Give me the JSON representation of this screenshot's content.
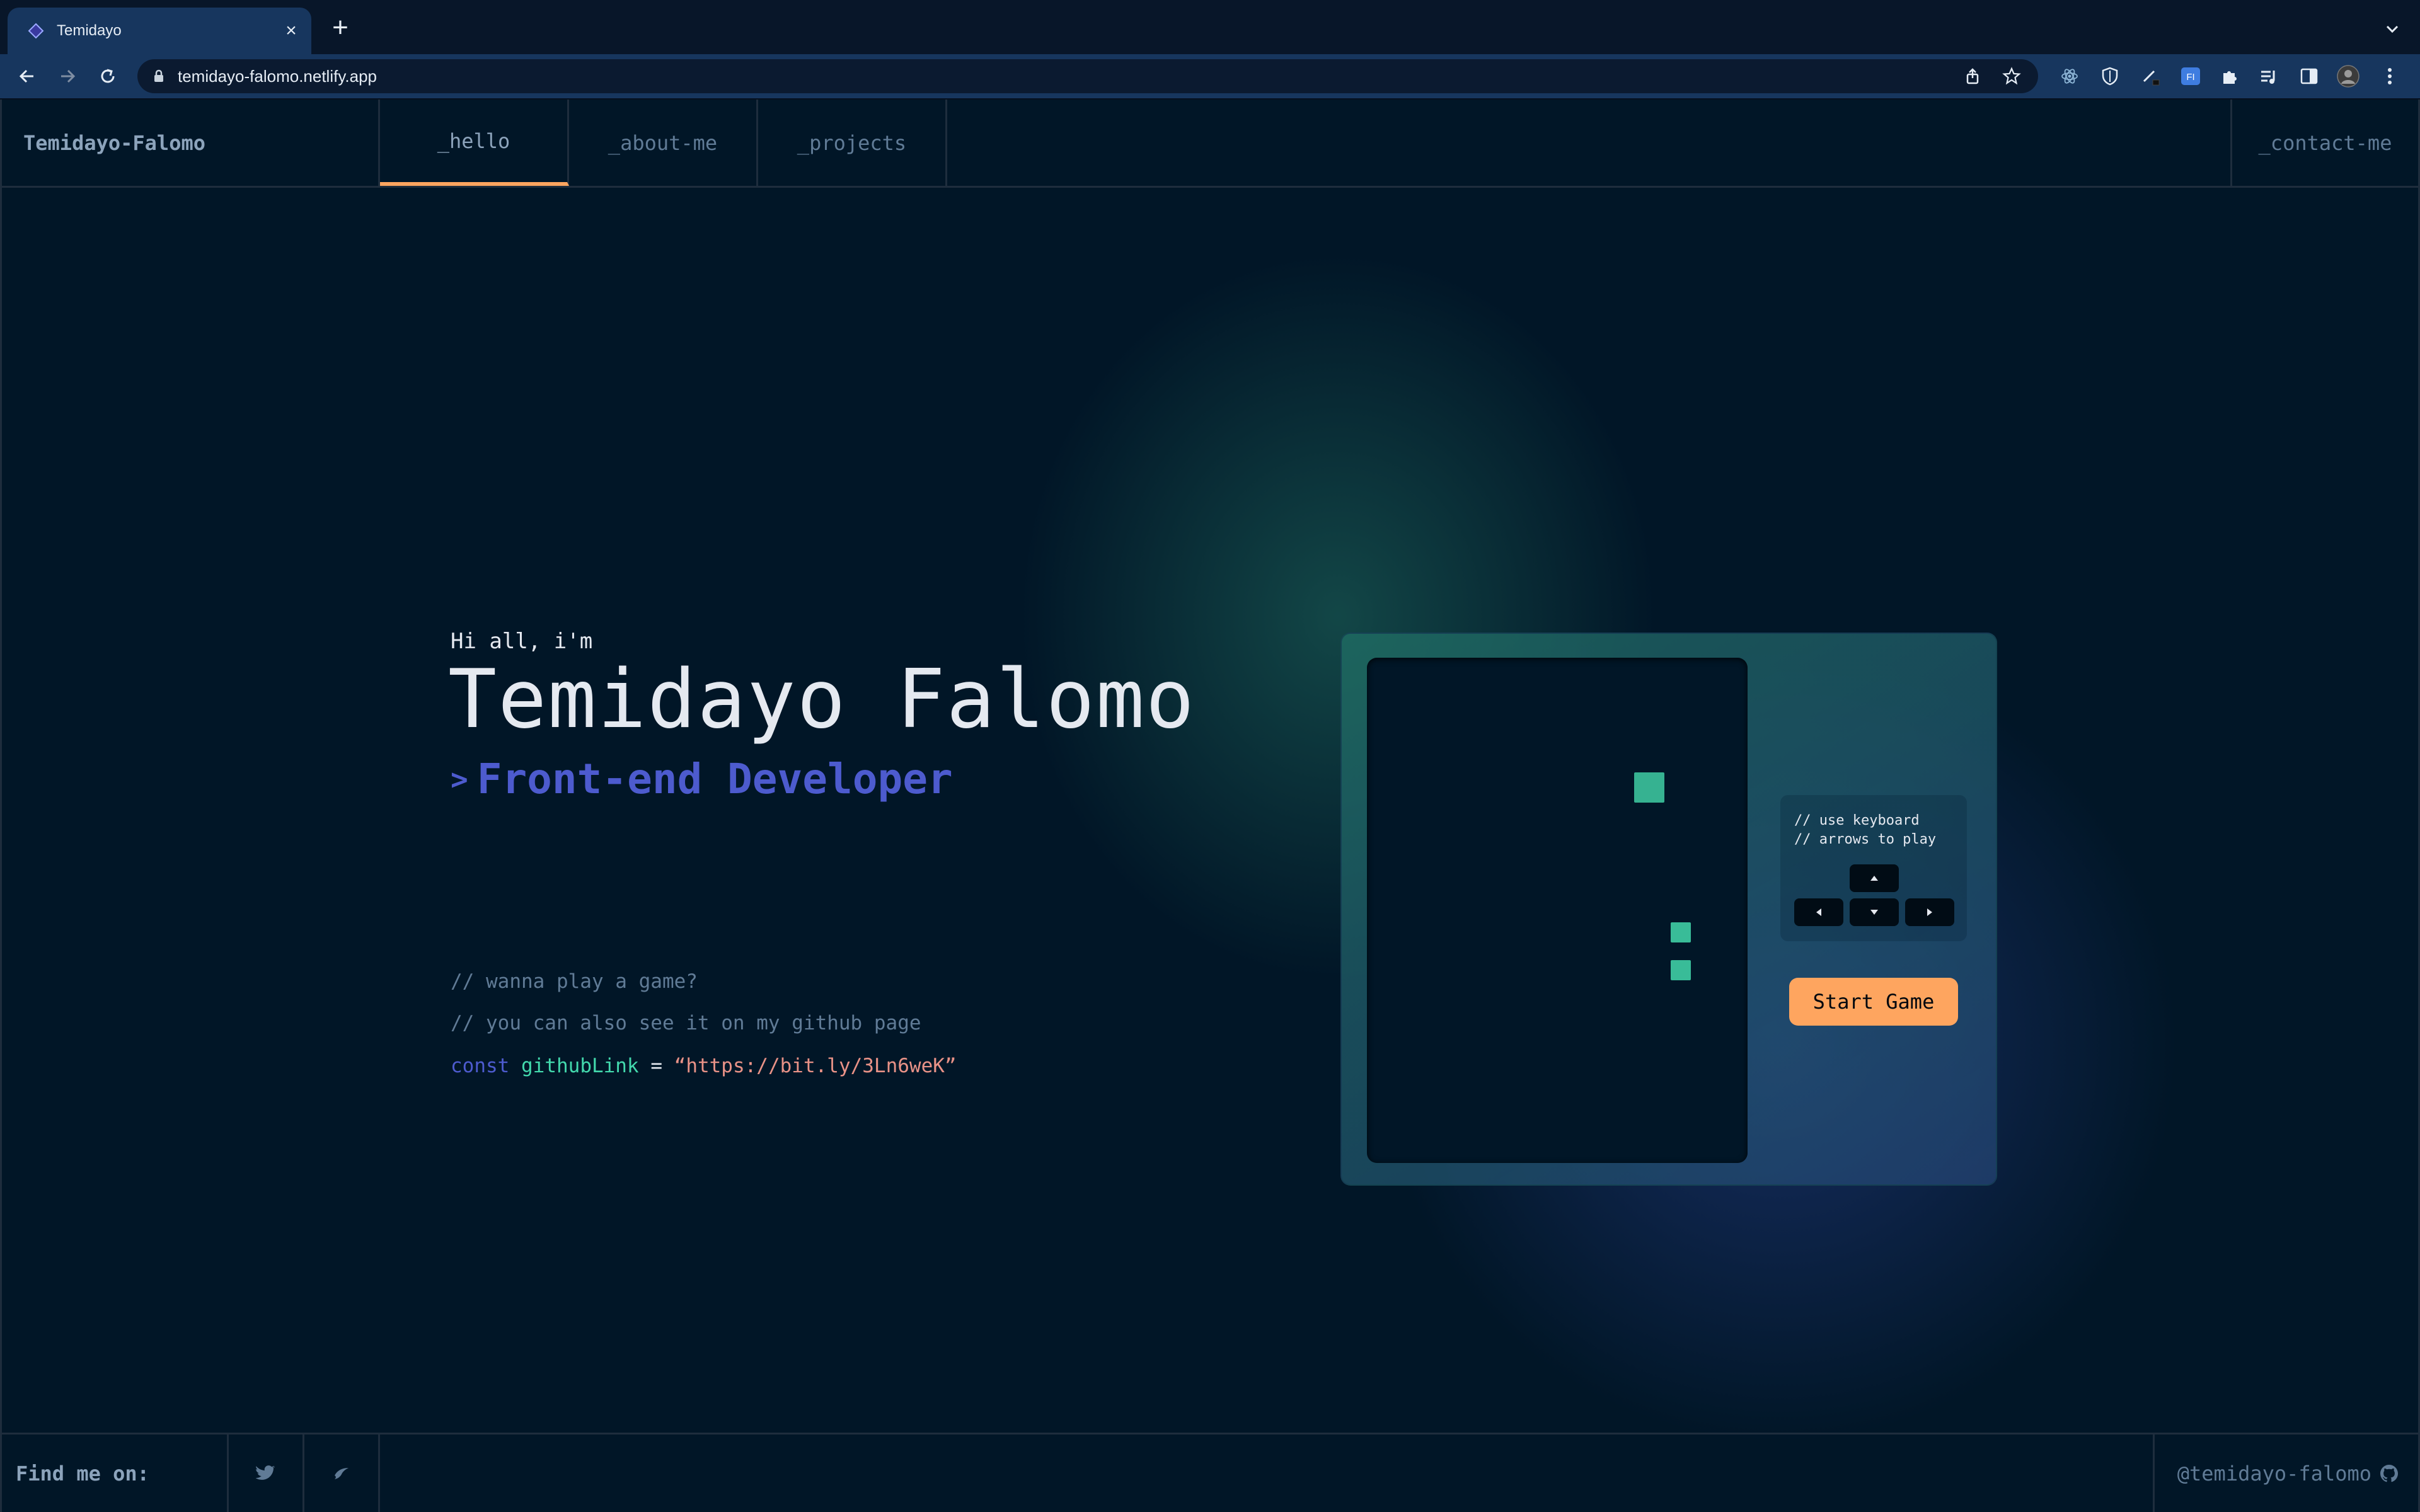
{
  "browser": {
    "tab_title": "Temidayo",
    "url": "temidayo-falomo.netlify.app"
  },
  "site": {
    "brand": "Temidayo-Falomo",
    "nav": [
      "_hello",
      "_about-me",
      "_projects"
    ],
    "nav_active": "_hello",
    "contact": "_contact-me"
  },
  "hero": {
    "greeting": "Hi all, i'm",
    "name": "Temidayo Falomo",
    "role_prefix": ">",
    "role": "Front-end Developer",
    "comment1": "// wanna play a game?",
    "comment2": "// you can also see it on my github page",
    "code": {
      "keyword": "const",
      "variable": "githubLink",
      "operator": "=",
      "string": "“https://bit.ly/3Ln6weK”"
    }
  },
  "game": {
    "hint": "// use keyboard\n// arrows to play",
    "start_label": "Start Game"
  },
  "footer": {
    "find_me": "Find me on:",
    "github_handle": "@temidayo-falomo"
  },
  "colors": {
    "accent_orange": "#fea55f",
    "accent_green": "#43d9ad",
    "accent_purple": "#4d5bce",
    "string_pink": "#e99287",
    "muted": "#607b96",
    "background": "#011627"
  },
  "icons": {
    "social": [
      "twitter-icon",
      "hashnode-icon"
    ],
    "github": "github-icon"
  }
}
